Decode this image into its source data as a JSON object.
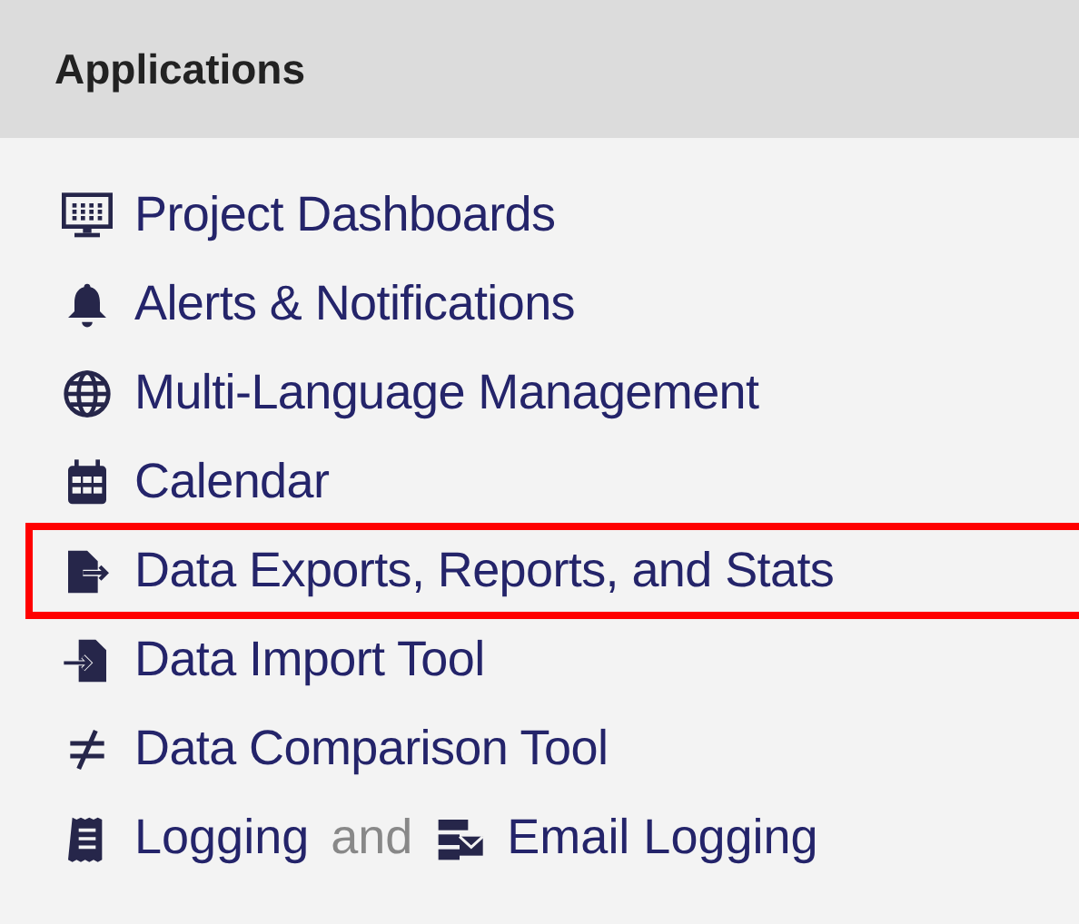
{
  "panel": {
    "title": "Applications"
  },
  "items": [
    {
      "kind": "single",
      "label": "Project Dashboards",
      "highlighted": false
    },
    {
      "kind": "single",
      "label": "Alerts & Notifications",
      "highlighted": false
    },
    {
      "kind": "single",
      "label": "Multi-Language Management",
      "highlighted": false
    },
    {
      "kind": "single",
      "label": "Calendar",
      "highlighted": false
    },
    {
      "kind": "single",
      "label": "Data Exports, Reports, and Stats",
      "highlighted": true
    },
    {
      "kind": "single",
      "label": "Data Import Tool",
      "highlighted": false
    },
    {
      "kind": "single",
      "label": "Data Comparison Tool",
      "highlighted": false
    },
    {
      "kind": "pair",
      "label": "Logging",
      "joiner": "and",
      "second_label": "Email Logging",
      "highlighted": false
    }
  ]
}
